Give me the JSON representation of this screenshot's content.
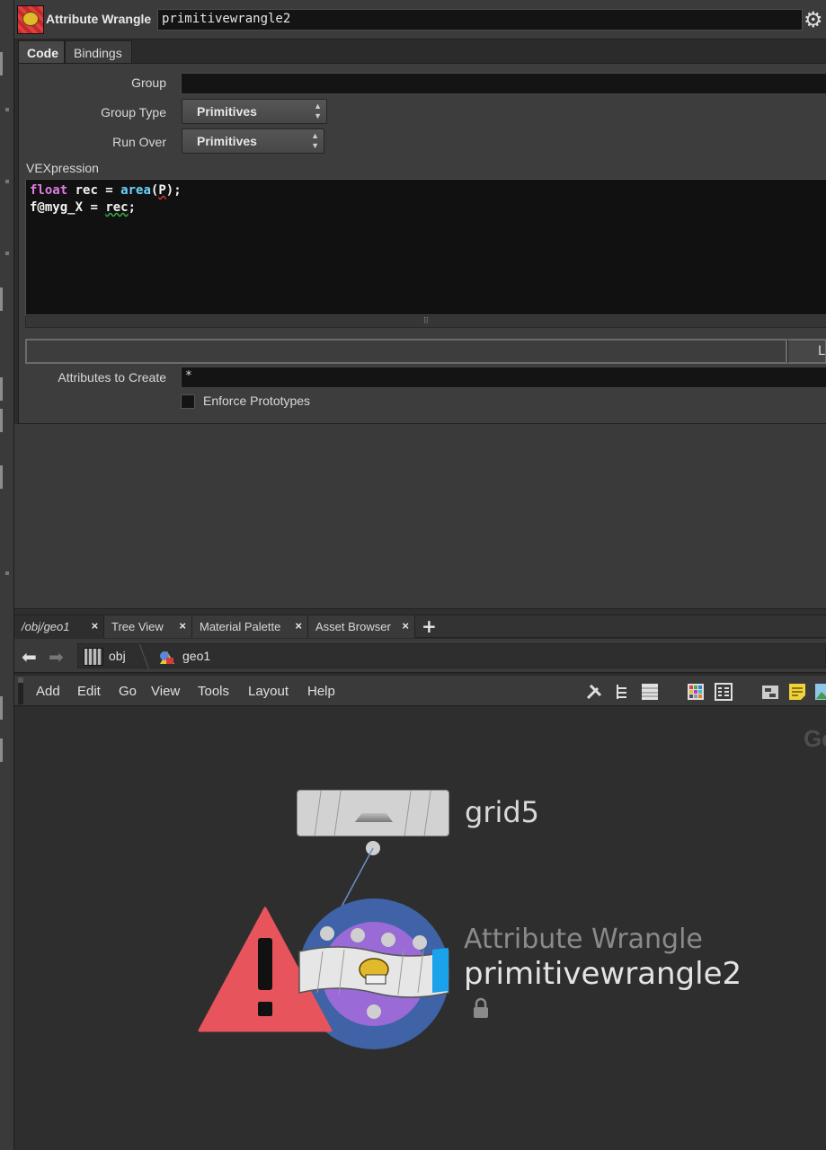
{
  "header": {
    "node_type": "Attribute Wrangle",
    "node_name": "primitivewrangle2"
  },
  "tabs": {
    "code": "Code",
    "bindings": "Bindings"
  },
  "parms": {
    "group_label": "Group",
    "group_value": "",
    "group_type_label": "Group Type",
    "group_type_value": "Primitives",
    "run_over_label": "Run Over",
    "run_over_value": "Primitives",
    "vex_label": "VEXpression",
    "code_line1": {
      "kw": "float",
      "var": " rec = ",
      "fn": "area",
      "rest": "(",
      "arg": "P",
      "end": ");"
    },
    "code_line2": {
      "a": "f@myg_X",
      "b": " = ",
      "c": "rec",
      "d": ";"
    },
    "lib_button": "Li",
    "attributes_label": "Attributes to Create",
    "attributes_value": "*",
    "enforce_label": "Enforce Prototypes"
  },
  "network_tabs": [
    {
      "label": "/obj/geo1"
    },
    {
      "label": "Tree View"
    },
    {
      "label": "Material Palette"
    },
    {
      "label": "Asset Browser"
    }
  ],
  "tab_close": "×",
  "tab_add": "+",
  "path": {
    "obj": "obj",
    "geo": "geo1"
  },
  "menu": {
    "add": "Add",
    "edit": "Edit",
    "go": "Go",
    "view": "View",
    "tools": "Tools",
    "layout": "Layout",
    "help": "Help"
  },
  "network": {
    "corner_text": "Ge",
    "grid_node_name": "grid5",
    "wrangle_node_type": "Attribute Wrangle",
    "wrangle_node_name": "primitivewrangle2"
  },
  "colors": {
    "keyword": "#e07ae0",
    "function": "#67d6ff",
    "warning": "#e8545c",
    "wrangle_ring": "#3f63a6",
    "wrangle_inner": "#9a6ad6",
    "selected_flag": "#1aa3ea"
  },
  "icons": [
    "gear-icon",
    "back-arrow-icon",
    "forward-arrow-icon",
    "tools-icon",
    "tree-icon",
    "list-icon",
    "palette-icon",
    "details-icon",
    "network-icon",
    "sticky-note-icon",
    "image-icon",
    "lock-icon",
    "warning-icon"
  ]
}
